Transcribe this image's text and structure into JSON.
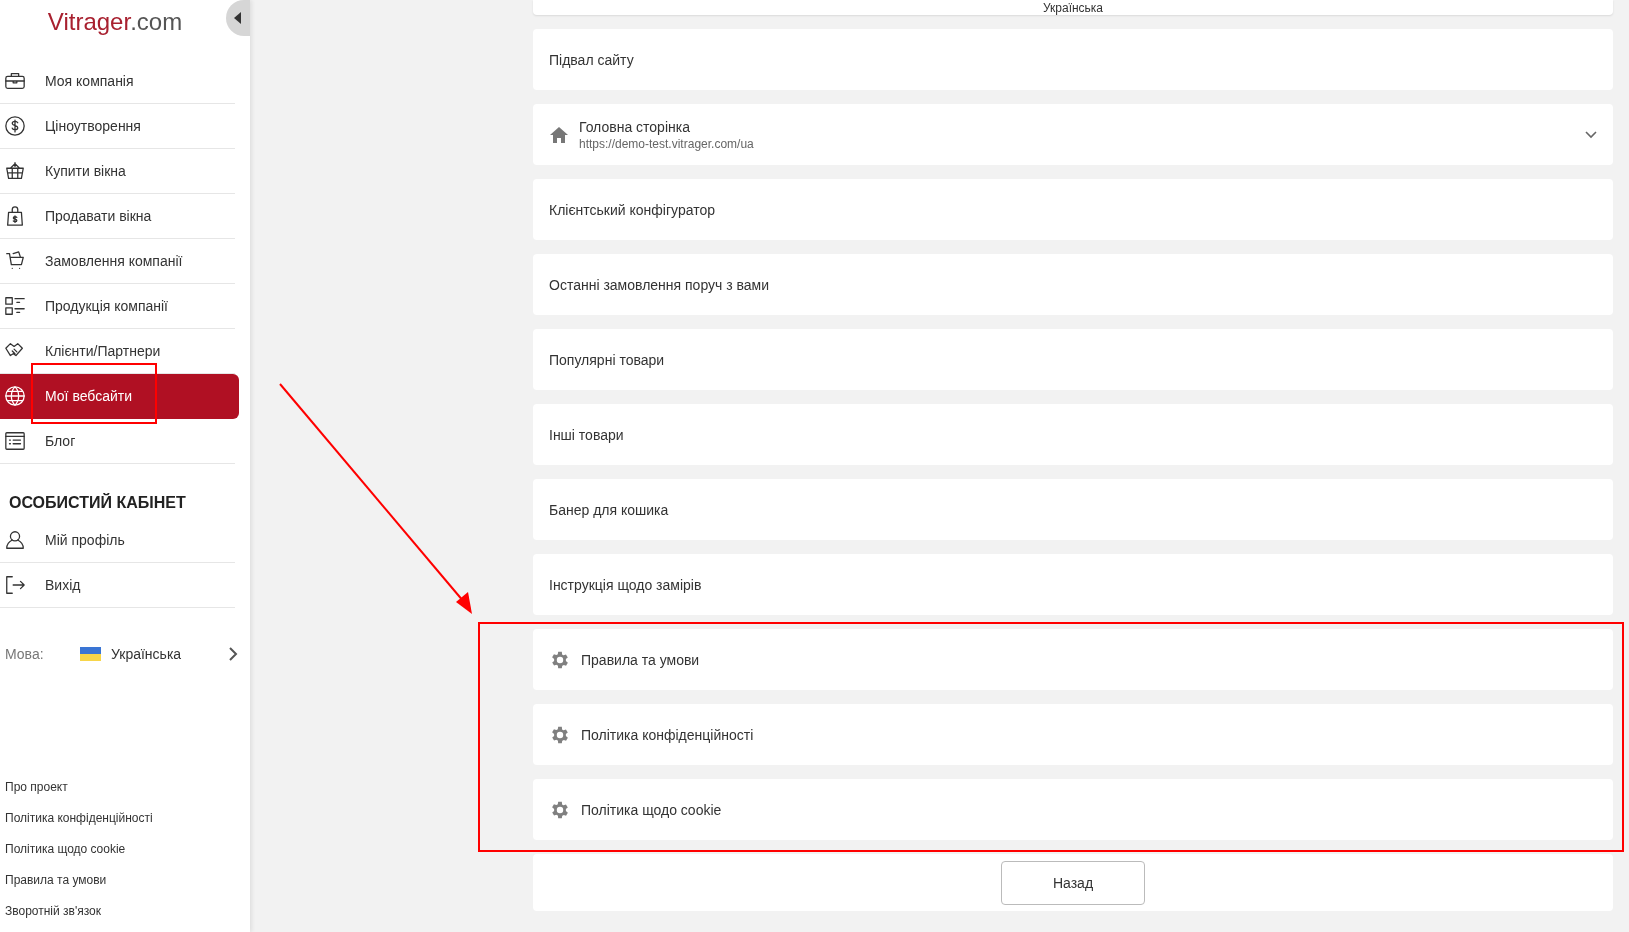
{
  "sidebar": {
    "logo": {
      "brand": "Vitrager",
      "suffix": ".com"
    },
    "menu": [
      {
        "label": "Моя компанія",
        "kind": "briefcase",
        "selected": false
      },
      {
        "label": "Ціноутворення",
        "kind": "dollar",
        "selected": false
      },
      {
        "label": "Купити вікна",
        "kind": "basket",
        "selected": false
      },
      {
        "label": "Продавати вікна",
        "kind": "bag",
        "selected": false
      },
      {
        "label": "Замовлення компанії",
        "kind": "cart",
        "selected": false
      },
      {
        "label": "Продукція компанії",
        "kind": "list",
        "selected": false
      },
      {
        "label": "Клієнти/Партнери",
        "kind": "handshake",
        "selected": false
      },
      {
        "label": "Мої вебсайти",
        "kind": "globe",
        "selected": true
      },
      {
        "label": "Блог",
        "kind": "article",
        "selected": false
      }
    ],
    "section_title": "ОСОБИСТИЙ КАБІНЕТ",
    "account": [
      {
        "label": "Мій профіль",
        "kind": "user"
      },
      {
        "label": "Вихід",
        "kind": "exit"
      }
    ],
    "language": {
      "label": "Мова:",
      "value": "Українська"
    },
    "footer_links": [
      "Про проект",
      "Політика конфіденційності",
      "Політика щодо cookie",
      "Правила та умови",
      "Зворотній зв'язок"
    ]
  },
  "main": {
    "top_card": "Українська",
    "cards": [
      {
        "kind": "plain",
        "title": "Підвал сайту"
      },
      {
        "kind": "page",
        "title": "Головна сторінка",
        "url": "https://demo-test.vitrager.com/ua"
      },
      {
        "kind": "plain",
        "title": "Клієнтський конфігуратор"
      },
      {
        "kind": "plain",
        "title": "Останні замовлення поруч з вами"
      },
      {
        "kind": "plain",
        "title": "Популярні товари"
      },
      {
        "kind": "plain",
        "title": "Інші товари"
      },
      {
        "kind": "plain",
        "title": "Банер для кошика"
      },
      {
        "kind": "plain",
        "title": "Інструкція щодо замірів"
      },
      {
        "kind": "settings",
        "title": "Правила та умови"
      },
      {
        "kind": "settings",
        "title": "Політика конфіденційності"
      },
      {
        "kind": "settings",
        "title": "Політика щодо cookie"
      }
    ],
    "back_button": "Назад"
  }
}
